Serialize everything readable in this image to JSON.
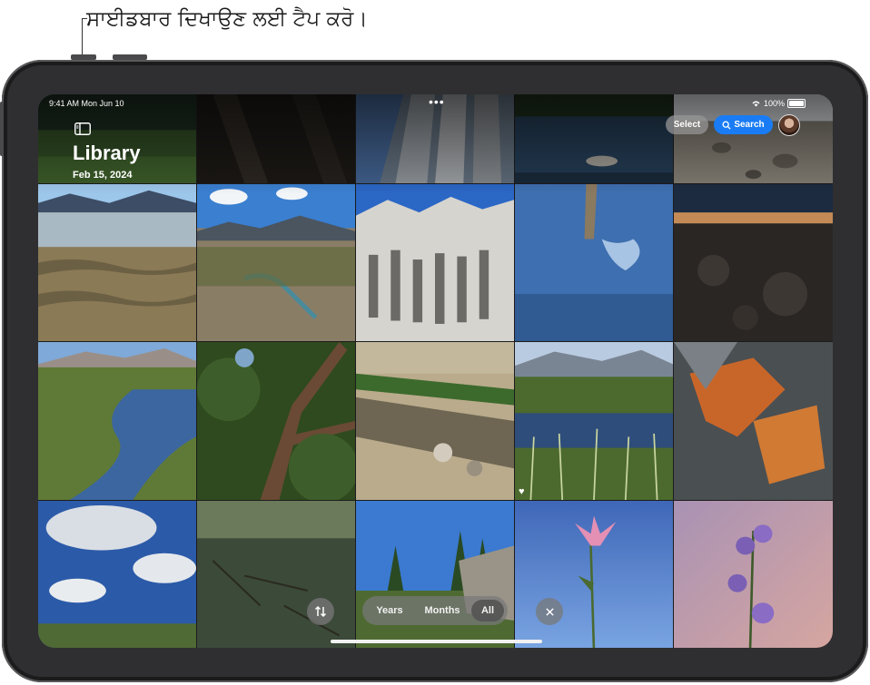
{
  "callout": {
    "text": "ਸਾਈਡਬਾਰ ਦਿਖਾਉਣ ਲਈ ਟੈਪ ਕਰੋ।"
  },
  "status_bar": {
    "time": "9:41 AM  Mon Jun 10",
    "battery": "100%",
    "multitask_dots": "•••"
  },
  "header": {
    "title": "Library",
    "date": "Feb 15, 2024",
    "select_label": "Select",
    "search_label": "Search"
  },
  "bottom_bar": {
    "segments": [
      {
        "label": "Years",
        "active": false
      },
      {
        "label": "Months",
        "active": false
      },
      {
        "label": "All",
        "active": true
      }
    ]
  },
  "icons": {
    "sidebar": "sidebar-icon",
    "search": "search-icon",
    "sort": "sort-arrows-icon",
    "close": "close-icon",
    "wifi": "wifi-icon",
    "battery": "battery-icon",
    "favorite": "heart-icon"
  },
  "colors": {
    "accent": "#1a7cf5",
    "device_frame": "#2f2f31"
  }
}
